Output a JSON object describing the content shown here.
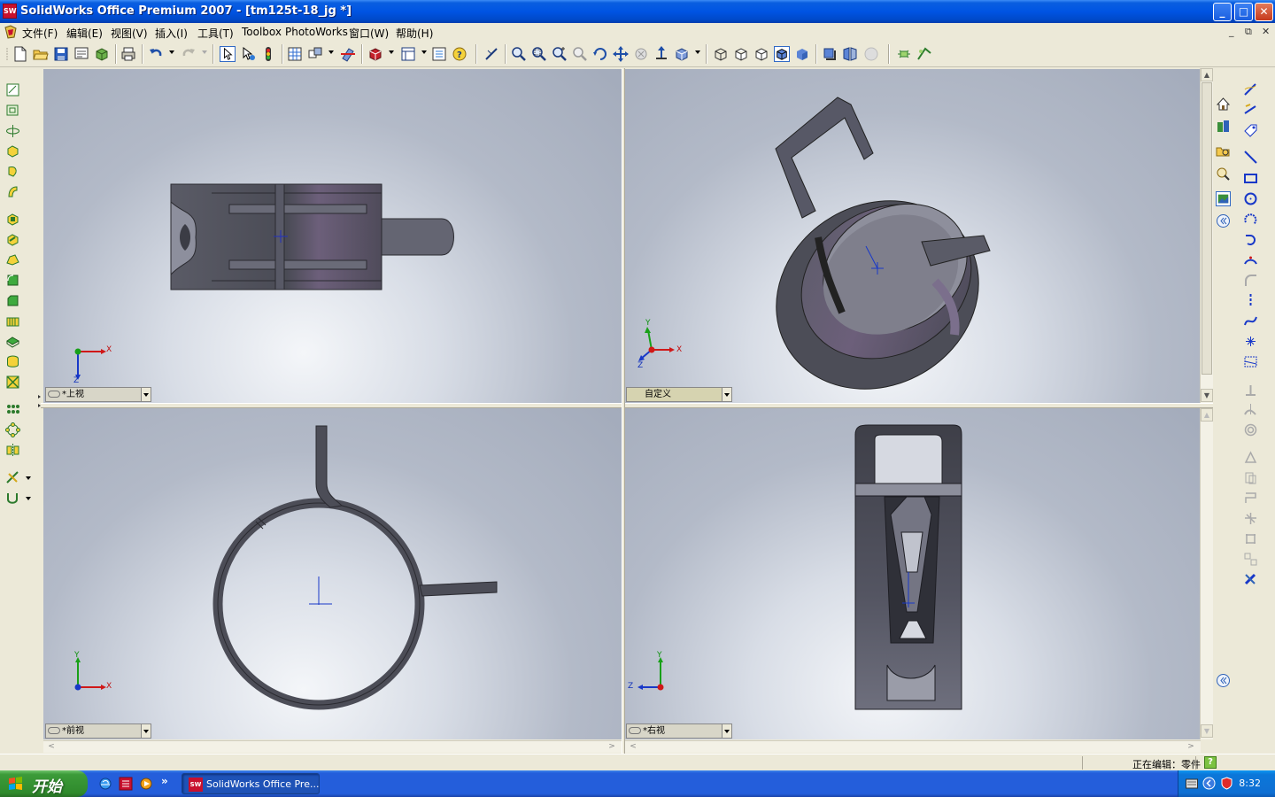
{
  "window": {
    "title": "SolidWorks Office Premium 2007 - [tm125t-18_jg *]",
    "app_icon_text": "SW",
    "minimize": "_",
    "maximize": "□",
    "close": "✕"
  },
  "menu": {
    "items": [
      "文件(F)",
      "编辑(E)",
      "视图(V)",
      "插入(I)",
      "工具(T)",
      "Toolbox",
      "PhotoWorks",
      "窗口(W)",
      "帮助(H)"
    ],
    "doc_controls": [
      "_",
      "⧉",
      "✕"
    ]
  },
  "viewports": {
    "top_left": {
      "label": "*上视",
      "triad": {
        "x": "X",
        "z": "Z"
      }
    },
    "top_right": {
      "label": "自定义",
      "triad": {
        "x": "X",
        "y": "Y",
        "z": "Z"
      }
    },
    "bottom_left": {
      "label": "*前视",
      "triad": {
        "x": "X",
        "y": "Y"
      }
    },
    "bottom_right": {
      "label": "*右视",
      "triad": {
        "y": "Y",
        "z": "Z"
      }
    }
  },
  "status": {
    "editing_text": "正在编辑：零件",
    "help": "?"
  },
  "taskbar": {
    "start_label": "开始",
    "task_item": "SolidWorks Office Pre...",
    "task_icon_text": "SW",
    "clock": "8:32",
    "quick_launch_more": "»"
  },
  "colors": {
    "title_bar": "#0054e3",
    "viewport_background": "#b3bac8",
    "model_dark": "#4c4d57",
    "model_highlight": "#6c5f7a",
    "triad_x": "#d01818",
    "triad_y": "#18a018",
    "triad_z": "#1838c8"
  }
}
